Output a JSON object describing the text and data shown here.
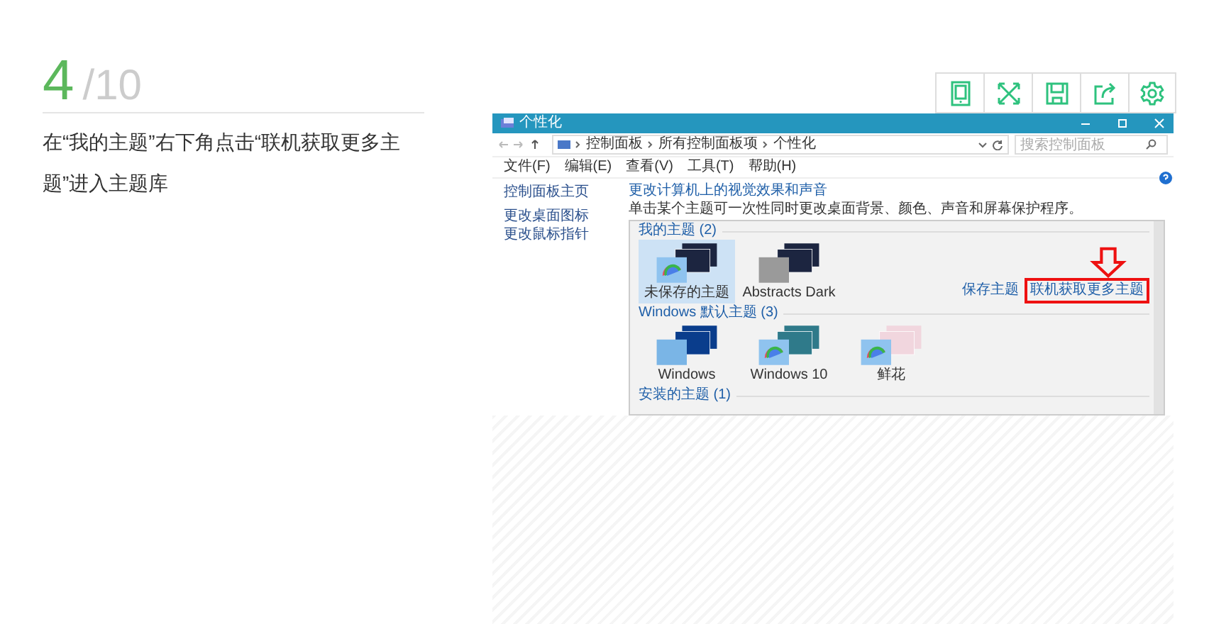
{
  "step": {
    "number": "4",
    "total": "/10",
    "text": "在“我的主题”右下角点击“联机获取更多主题”进入主题库"
  },
  "screenshot": {
    "window_title": "个性化",
    "breadcrumb": [
      "控制面板",
      "所有控制面板项",
      "个性化"
    ],
    "search": {
      "placeholder": "搜索控制面板"
    },
    "menu": [
      "文件(F)",
      "编辑(E)",
      "查看(V)",
      "工具(T)",
      "帮助(H)"
    ],
    "sidebar": [
      "控制面板主页",
      "更改桌面图标",
      "更改鼠标指针"
    ],
    "heading": "更改计算机上的视觉效果和声音",
    "description": "单击某个主题可一次性同时更改桌面背景、颜色、声音和屏幕保护程序。",
    "groups": [
      {
        "title": "我的主题 (2)",
        "themes": [
          {
            "label": "未保存的主题",
            "kind": "fan-dark",
            "selected": true
          },
          {
            "label": "Abstracts Dark",
            "kind": "grey-dark",
            "selected": false
          }
        ],
        "links": [
          "保存主题",
          "联机获取更多主题"
        ]
      },
      {
        "title": "Windows 默认主题 (3)",
        "themes": [
          {
            "label": "Windows",
            "kind": "windows",
            "selected": false
          },
          {
            "label": "Windows 10",
            "kind": "fan-teal",
            "selected": false
          },
          {
            "label": "鲜花",
            "kind": "fan-flowers",
            "selected": false
          }
        ]
      },
      {
        "title": "安装的主题 (1)"
      }
    ]
  }
}
